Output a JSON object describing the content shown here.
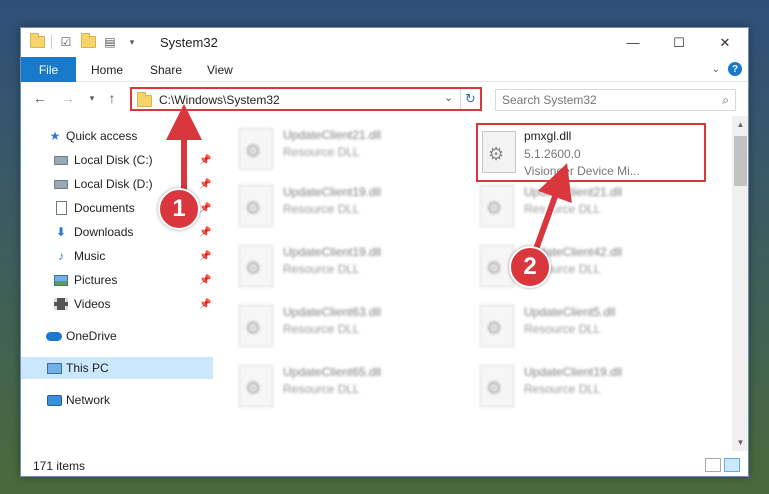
{
  "window": {
    "title": "System32"
  },
  "controls": {
    "minimize": "—",
    "maximize": "☐",
    "close": "✕"
  },
  "ribbon": {
    "file": "File",
    "home": "Home",
    "share": "Share",
    "view": "View"
  },
  "address": {
    "path": "C:\\Windows\\System32"
  },
  "search": {
    "placeholder": "Search System32"
  },
  "sidebar": {
    "items": [
      {
        "label": "Quick access",
        "icon": "star-icon",
        "pinned": false
      },
      {
        "label": "Local Disk (C:)",
        "icon": "drive-icon",
        "pinned": true
      },
      {
        "label": "Local Disk (D:)",
        "icon": "drive-icon",
        "pinned": true
      },
      {
        "label": "Documents",
        "icon": "documents-icon",
        "pinned": true
      },
      {
        "label": "Downloads",
        "icon": "downloads-icon",
        "pinned": true
      },
      {
        "label": "Music",
        "icon": "music-icon",
        "pinned": true
      },
      {
        "label": "Pictures",
        "icon": "pictures-icon",
        "pinned": true
      },
      {
        "label": "Videos",
        "icon": "videos-icon",
        "pinned": true
      },
      {
        "label": "OneDrive",
        "icon": "onedrive-icon",
        "pinned": false
      },
      {
        "label": "This PC",
        "icon": "this-pc-icon",
        "pinned": false,
        "selected": true
      },
      {
        "label": "Network",
        "icon": "network-icon",
        "pinned": false
      }
    ]
  },
  "files": [
    {
      "name": "UpdateClient21.dll",
      "type": "Resource DLL"
    },
    {
      "name": "pmxgl.dll",
      "version": "5.1.2600.0",
      "description": "Visioneer Device Mi...",
      "selected": true
    },
    {
      "name": "UpdateClient19.dll",
      "type": "Resource DLL"
    },
    {
      "name": "UpdateClient21.dll",
      "type": "Resource DLL"
    },
    {
      "name": "UpdateClient19.dll",
      "type": "Resource DLL"
    },
    {
      "name": "UpdateClient42.dll",
      "type": "Resource DLL"
    },
    {
      "name": "UpdateClient63.dll",
      "type": "Resource DLL"
    },
    {
      "name": "UpdateClient5.dll",
      "type": "Resource DLL"
    },
    {
      "name": "UpdateClient65.dll",
      "type": "Resource DLL"
    },
    {
      "name": "UpdateClient19.dll",
      "type": "Resource DLL"
    }
  ],
  "status": {
    "count": "171 items"
  },
  "annotations": {
    "step1": "1",
    "step2": "2"
  },
  "colors": {
    "accent": "#1979ca",
    "highlight": "#d9363e",
    "selected": "#cce8ff"
  }
}
